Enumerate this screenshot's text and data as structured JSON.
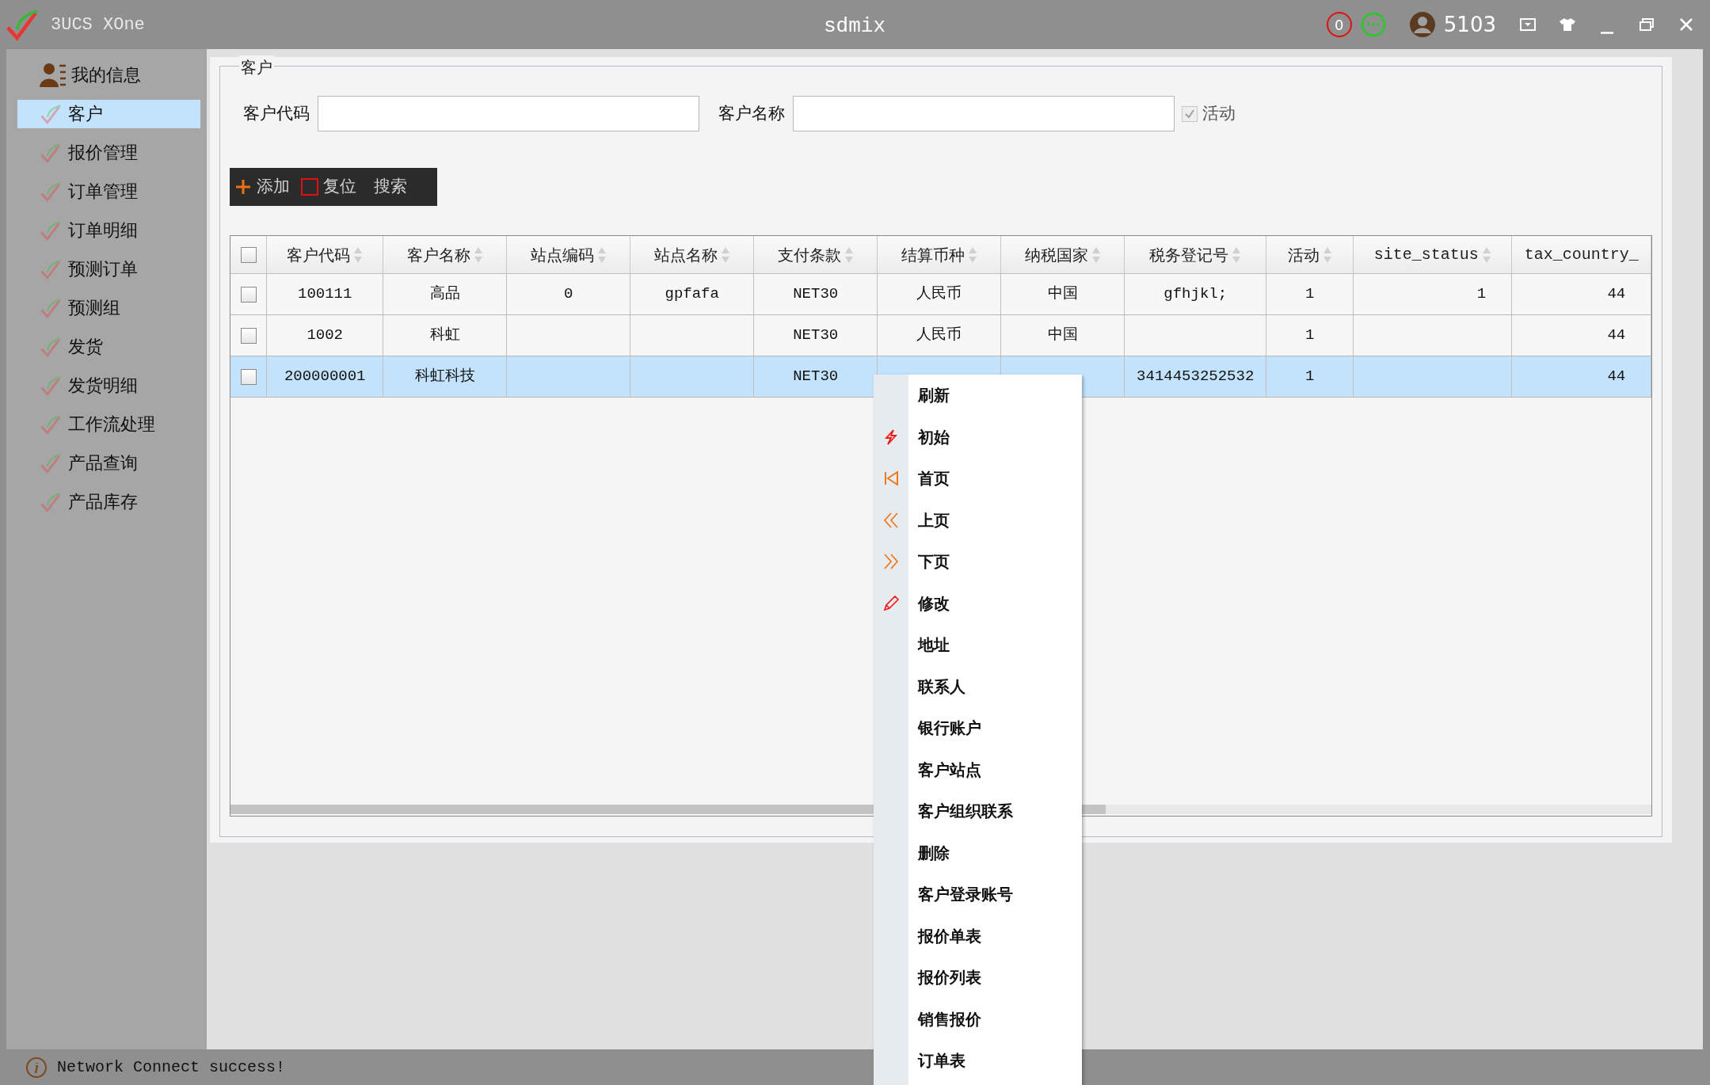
{
  "window": {
    "app_name": "3UCS XOne",
    "title": "sdmix",
    "notification_count": "0",
    "user": "5103"
  },
  "sidebar": {
    "header": "我的信息",
    "items": [
      {
        "label": "客户",
        "selected": true
      },
      {
        "label": "报价管理",
        "selected": false
      },
      {
        "label": "订单管理",
        "selected": false
      },
      {
        "label": "订单明细",
        "selected": false
      },
      {
        "label": "预测订单",
        "selected": false
      },
      {
        "label": "预测组",
        "selected": false
      },
      {
        "label": "发货",
        "selected": false
      },
      {
        "label": "发货明细",
        "selected": false
      },
      {
        "label": "工作流处理",
        "selected": false
      },
      {
        "label": "产品查询",
        "selected": false
      },
      {
        "label": "产品库存",
        "selected": false
      }
    ]
  },
  "panel": {
    "legend": "客户",
    "fields": [
      {
        "label": "客户代码"
      },
      {
        "label": "客户名称"
      }
    ],
    "active_checkbox": {
      "label": "活动",
      "checked": true,
      "disabled": true
    }
  },
  "toolbar": [
    {
      "label": "添加",
      "kind": "add"
    },
    {
      "label": "复位",
      "kind": "reset"
    },
    {
      "label": "搜索",
      "kind": "search"
    }
  ],
  "table": {
    "header_checked": false,
    "columns": [
      "客户代码",
      "客户名称",
      "站点编码",
      "站点名称",
      "支付条款",
      "结算币种",
      "纳税国家",
      "税务登记号",
      "活动",
      "site_status",
      "tax_country_"
    ],
    "rows": [
      {
        "checked": false,
        "selected": false,
        "cells": [
          "100111",
          "高品",
          "0",
          "gpfafa",
          "NET30",
          "人民币",
          "中国",
          "gfhjkl;",
          "1",
          "1",
          "44"
        ]
      },
      {
        "checked": false,
        "selected": false,
        "cells": [
          "1002",
          "科虹",
          null,
          null,
          "NET30",
          "人民币",
          "中国",
          null,
          "1",
          null,
          "44"
        ]
      },
      {
        "checked": false,
        "selected": true,
        "cells": [
          "200000001",
          "科虹科技",
          null,
          null,
          "NET30",
          null,
          null,
          "3414453252532",
          "1",
          null,
          "44"
        ]
      }
    ]
  },
  "context_menu": {
    "items": [
      {
        "label": "刷新",
        "kind": "plain"
      },
      {
        "label": "初始",
        "kind": "bolt"
      },
      {
        "label": "首页",
        "kind": "first"
      },
      {
        "label": "上页",
        "kind": "prev"
      },
      {
        "label": "下页",
        "kind": "next"
      },
      {
        "label": "修改",
        "kind": "edit"
      },
      {
        "label": "地址",
        "kind": "plain"
      },
      {
        "label": "联系人",
        "kind": "plain"
      },
      {
        "label": "银行账户",
        "kind": "plain"
      },
      {
        "label": "客户站点",
        "kind": "plain"
      },
      {
        "label": "客户组织联系",
        "kind": "plain"
      },
      {
        "label": "删除",
        "kind": "plain"
      },
      {
        "label": "客户登录账号",
        "kind": "plain"
      },
      {
        "label": "报价单表",
        "kind": "plain"
      },
      {
        "label": "报价列表",
        "kind": "plain"
      },
      {
        "label": "销售报价",
        "kind": "plain"
      },
      {
        "label": "订单表",
        "kind": "plain"
      }
    ]
  },
  "status_bar": {
    "message": "Network Connect success!"
  }
}
